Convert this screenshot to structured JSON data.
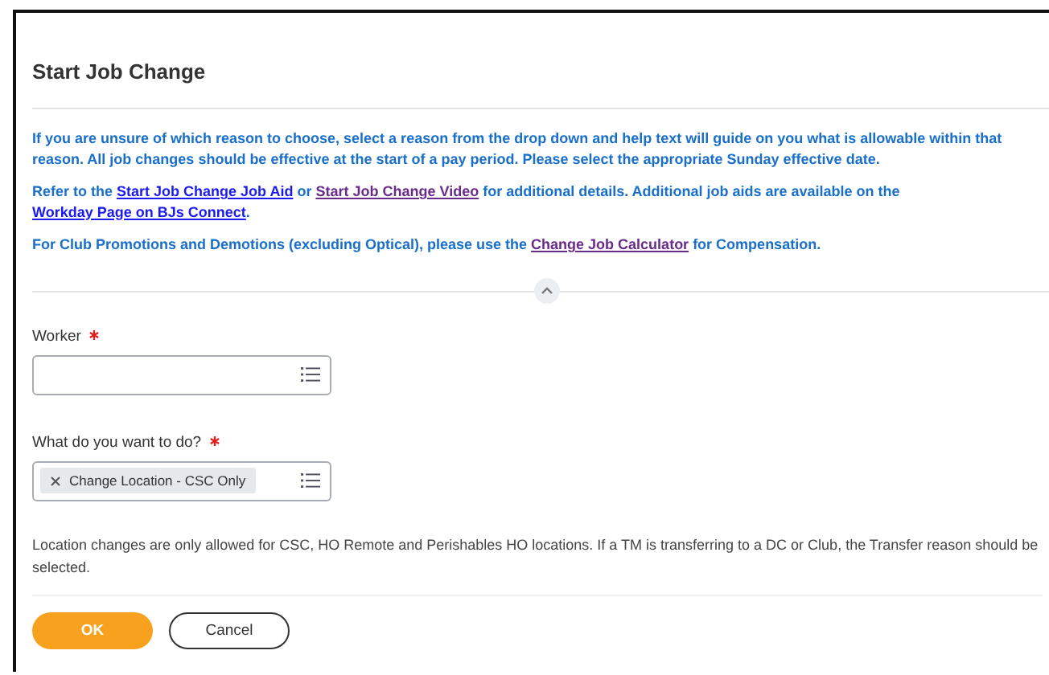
{
  "title": "Start Job Change",
  "instructions": [
    {
      "segments": [
        {
          "text": "If you are unsure of which reason to choose, select a reason from the drop down and help text will guide on you what is allowable within that reason. All job changes should be effective at the start of a pay period.  Please select the appropriate Sunday effective date."
        }
      ]
    },
    {
      "segments": [
        {
          "text": "Refer to the "
        },
        {
          "link": "Start Job Change Job Aid",
          "visited": false
        },
        {
          "text": " or "
        },
        {
          "link": "Start Job Change Video",
          "visited": true
        },
        {
          "text": " for additional details.  Additional job aids are available on the "
        },
        {
          "link": "Workday Page on BJs Connect",
          "visited": false
        },
        {
          "text": "."
        }
      ]
    },
    {
      "segments": [
        {
          "text": "For Club Promotions and Demotions (excluding Optical), please use the "
        },
        {
          "link": "Change Job Calculator",
          "visited": true
        },
        {
          "text": " for Compensation."
        }
      ]
    }
  ],
  "collapse": {
    "expanded": true
  },
  "fields": [
    {
      "label": "Worker",
      "required": true
    },
    {
      "label": "What do you want to do?",
      "required": true,
      "tokens": [
        "Change Location - CSC Only"
      ]
    }
  ],
  "help_text": "Location changes are only allowed for CSC, HO Remote and Perishables HO locations. If a TM is transferring to a DC or Club, the Transfer reason should be selected.",
  "buttons": [
    {
      "label": "OK",
      "kind": "primary"
    },
    {
      "label": "Cancel",
      "kind": "secondary"
    }
  ]
}
